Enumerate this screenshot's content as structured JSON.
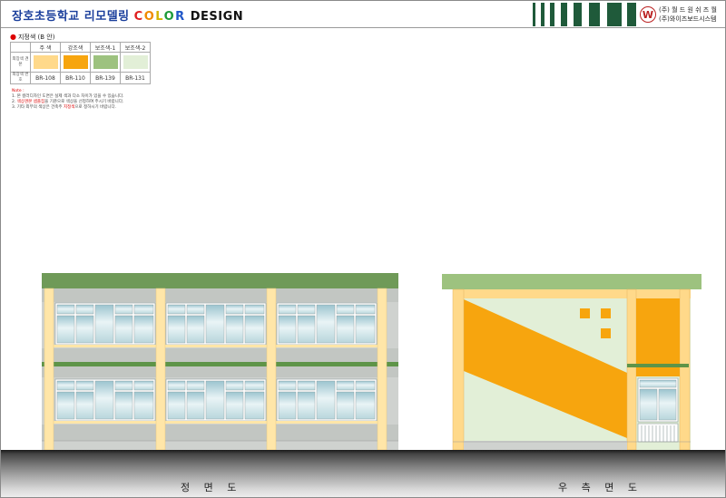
{
  "header": {
    "title_1": "장호초등학교",
    "title_2": " 리모델링 ",
    "title_color_letters": [
      "C",
      "O",
      "L",
      "O",
      "R"
    ],
    "title_color_hex": [
      "#e02020",
      "#f08a00",
      "#d4b400",
      "#1c9a3a",
      "#1f56c8"
    ],
    "title_3": " DESIGN",
    "logo_glyph": "W",
    "company_1": "(주) 월 드 원 쉬 즈 월",
    "company_2": "(주)와이즈보드시스템"
  },
  "spec": {
    "heading_marker": "●",
    "heading": "지정색 (B 안)",
    "columns": [
      "주 색",
      "강조색",
      "보조색-1",
      "보조색-2"
    ],
    "row_swatch_label": "외장색 견본",
    "row_code_label": "외장색 번호",
    "swatches": [
      "#ffd98a",
      "#f7a50e",
      "#9dc27f",
      "#e2efd7"
    ],
    "codes": [
      "BR-108",
      "BR-110",
      "BR-139",
      "BR-131"
    ]
  },
  "notes": {
    "title": "Note :",
    "line1": "1. 본 컬러디자인 도면은 실제 색과 다소 차이가 있을 수 있습니다.",
    "line2_pre": "2. ",
    "line2_red": "색상견본 샘플집",
    "line2_post": "을 기준으로 색상을 선정하여 주시기 바랍니다.",
    "line3_pre": "3. 기타 외부의 색상은 건축주 ",
    "line3_red": "지정색",
    "line3_post": "으로 정하시기 바랍니다."
  },
  "captions": {
    "front": "정 면 도",
    "side": "우 측 면 도"
  },
  "palette": {
    "main": "#ffd98a",
    "accent": "#f7a50e",
    "sub1": "#9dc27f",
    "sub2": "#e2efd7",
    "roof": "#6f9a58",
    "wall_gray": "#cfd2cf",
    "band_green": "#5e9448",
    "brand_dark": "#1f5a3a"
  }
}
